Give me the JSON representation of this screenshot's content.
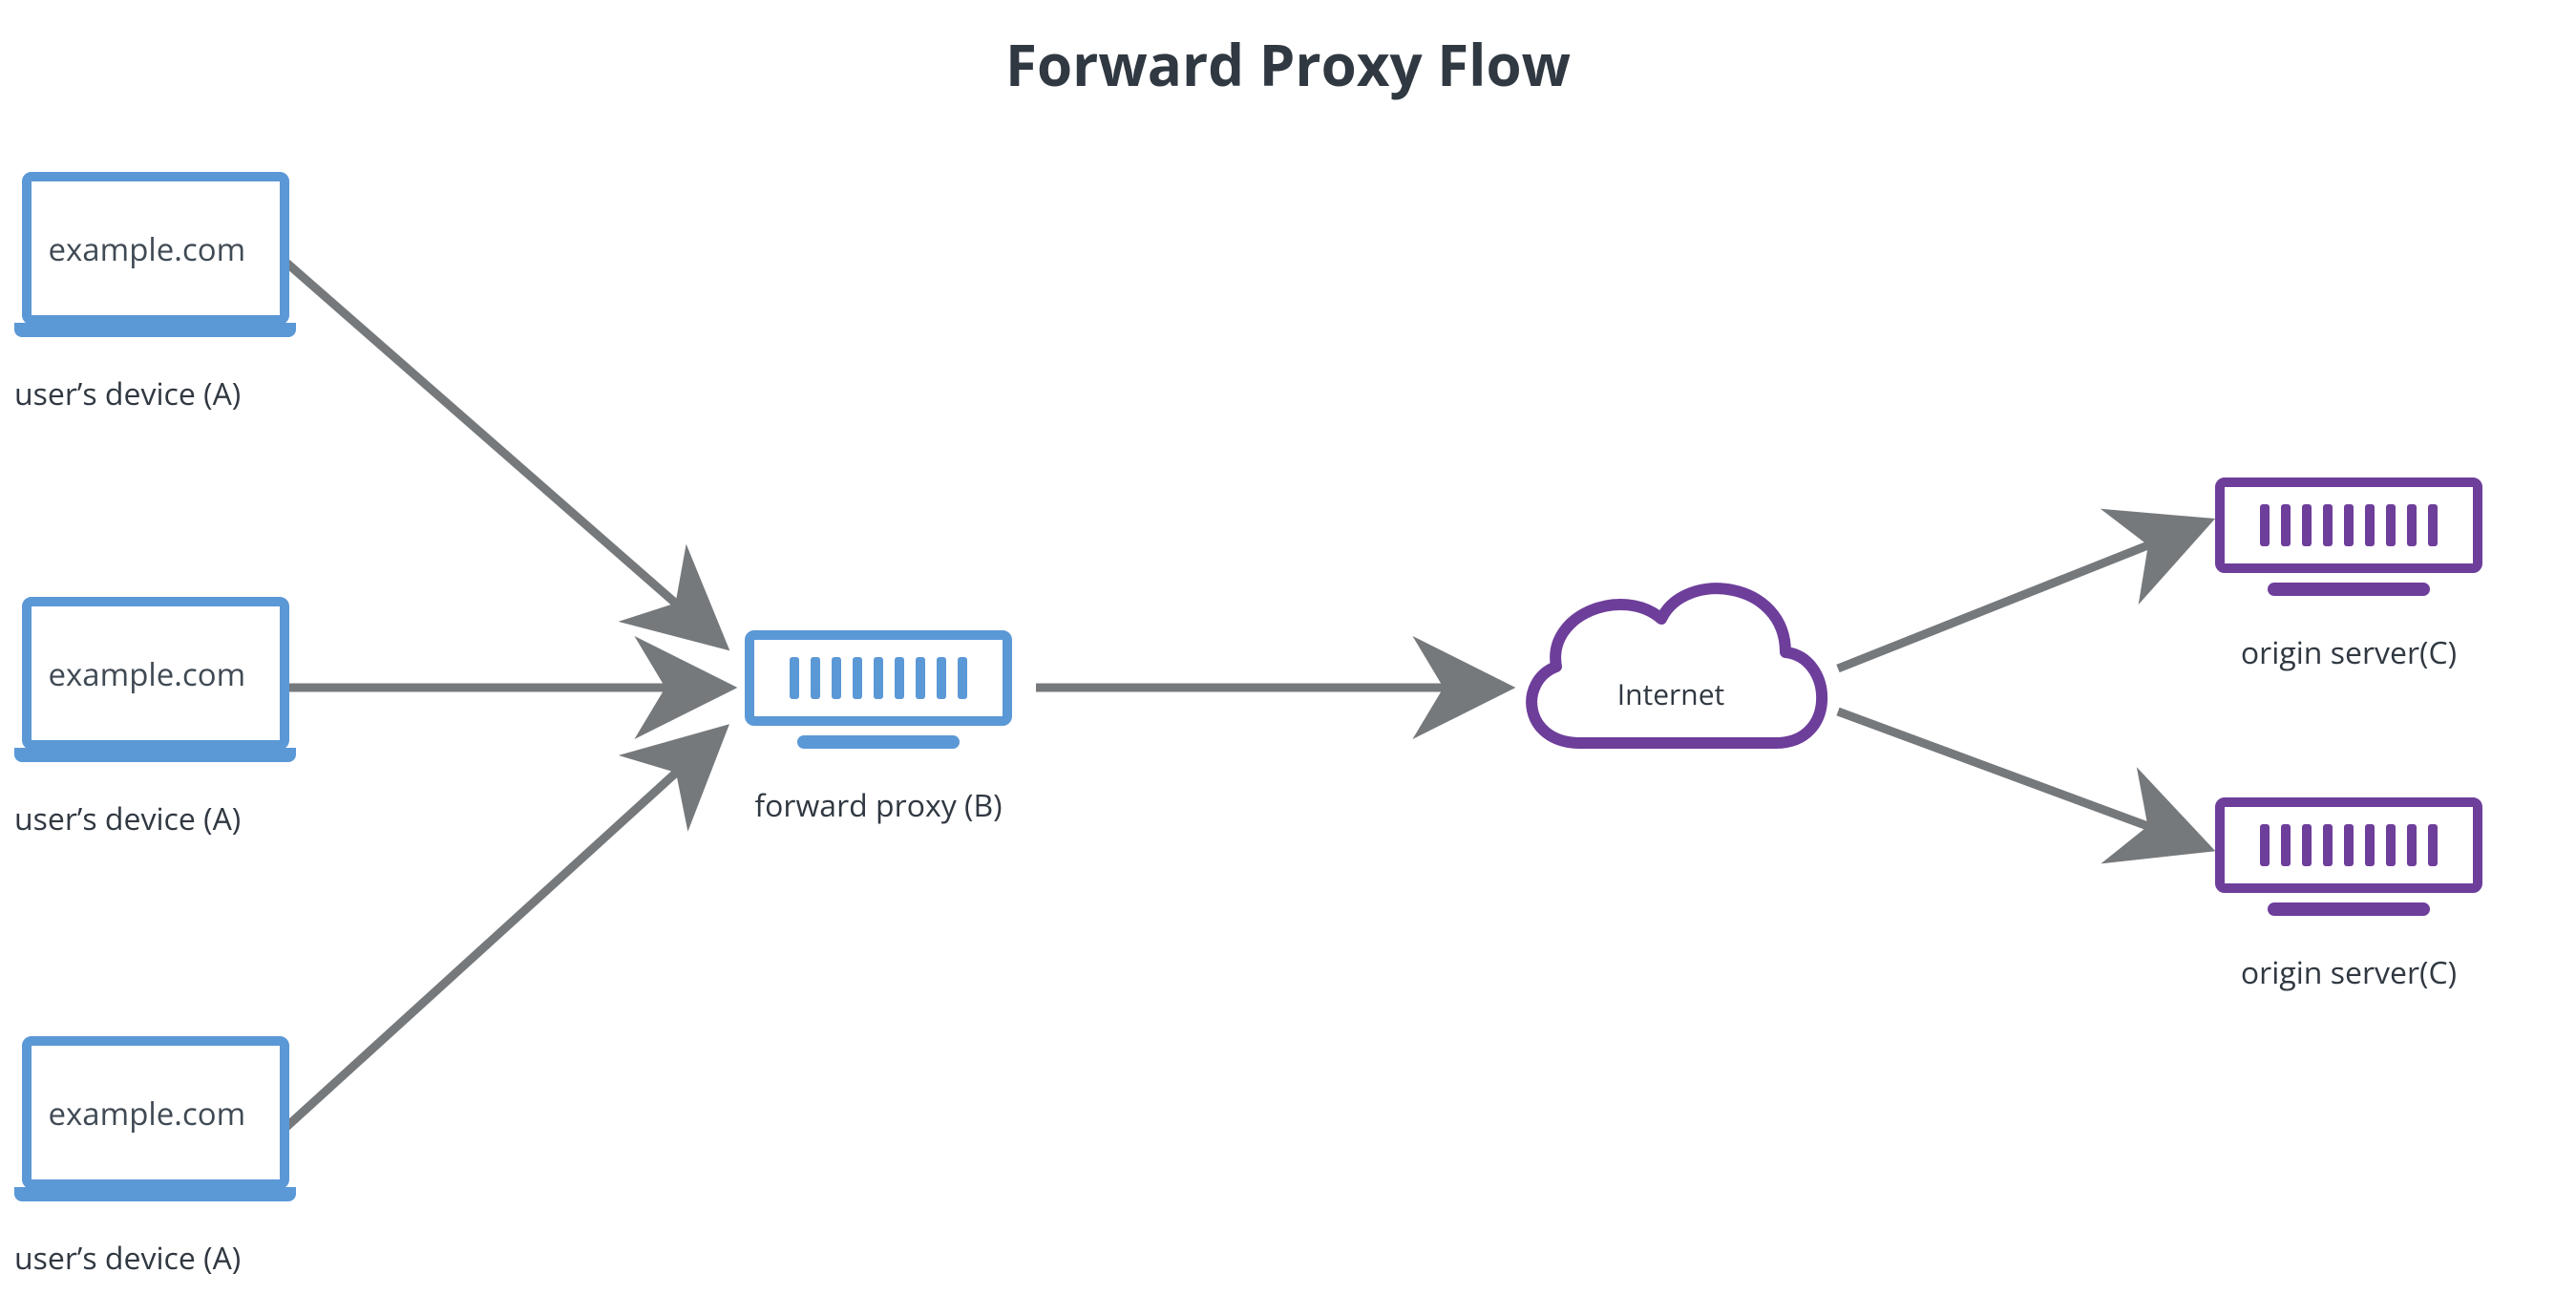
{
  "title": "Forward Proxy Flow",
  "devices": {
    "address_text": "example.com",
    "label": "user’s device (A)"
  },
  "proxy": {
    "label": "forward proxy (B)"
  },
  "cloud": {
    "label": "Internet"
  },
  "origin": {
    "label": "origin server(C)"
  },
  "colors": {
    "blue": "#5b98d6",
    "purple": "#6e3e9b",
    "arrow": "#76797c",
    "text": "#303841"
  }
}
